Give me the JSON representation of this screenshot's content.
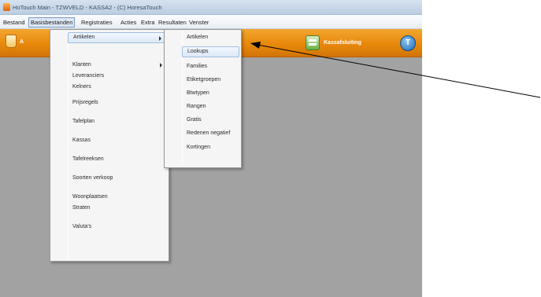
{
  "window": {
    "title": "HoTouch Main - TZWVELD - KASSA2 - (C) HoresaTouch"
  },
  "menubar": {
    "items": [
      {
        "label": "Bestand"
      },
      {
        "label": "Basisbestanden"
      },
      {
        "label": "Registraties"
      },
      {
        "label": "Acties"
      },
      {
        "label": "Extra"
      },
      {
        "label": "Resultaten"
      },
      {
        "label": "Venster"
      }
    ]
  },
  "toolbar": {
    "left_letter": "A",
    "register_label": "Kassafsluiting",
    "circle_letter": "T"
  },
  "main_menu": {
    "items": [
      {
        "label": "Artikelen"
      },
      {
        "label": "Klanten"
      },
      {
        "label": "Leveranciers"
      },
      {
        "label": "Kelners"
      },
      {
        "label": "Prijsregels"
      },
      {
        "label": "Tafelplan"
      },
      {
        "label": "Kassas"
      },
      {
        "label": "Tafelreeksen"
      },
      {
        "label": "Soorten verkoop"
      },
      {
        "label": "Woonplaatsen"
      },
      {
        "label": "Straten"
      },
      {
        "label": "Valuta's"
      }
    ]
  },
  "sub_menu": {
    "items": [
      {
        "label": "Artikelen"
      },
      {
        "label": "Lookups"
      },
      {
        "label": "Families"
      },
      {
        "label": "Etiketgroepen"
      },
      {
        "label": "Btwtypen"
      },
      {
        "label": "Rangen"
      },
      {
        "label": "Gratis"
      },
      {
        "label": "Redenen negatief"
      },
      {
        "label": "Kortingen"
      }
    ]
  },
  "colors": {
    "toolbar": "#e8880b",
    "workspace": "#a2a2a2",
    "menu_highlight": "#dce9f8"
  }
}
